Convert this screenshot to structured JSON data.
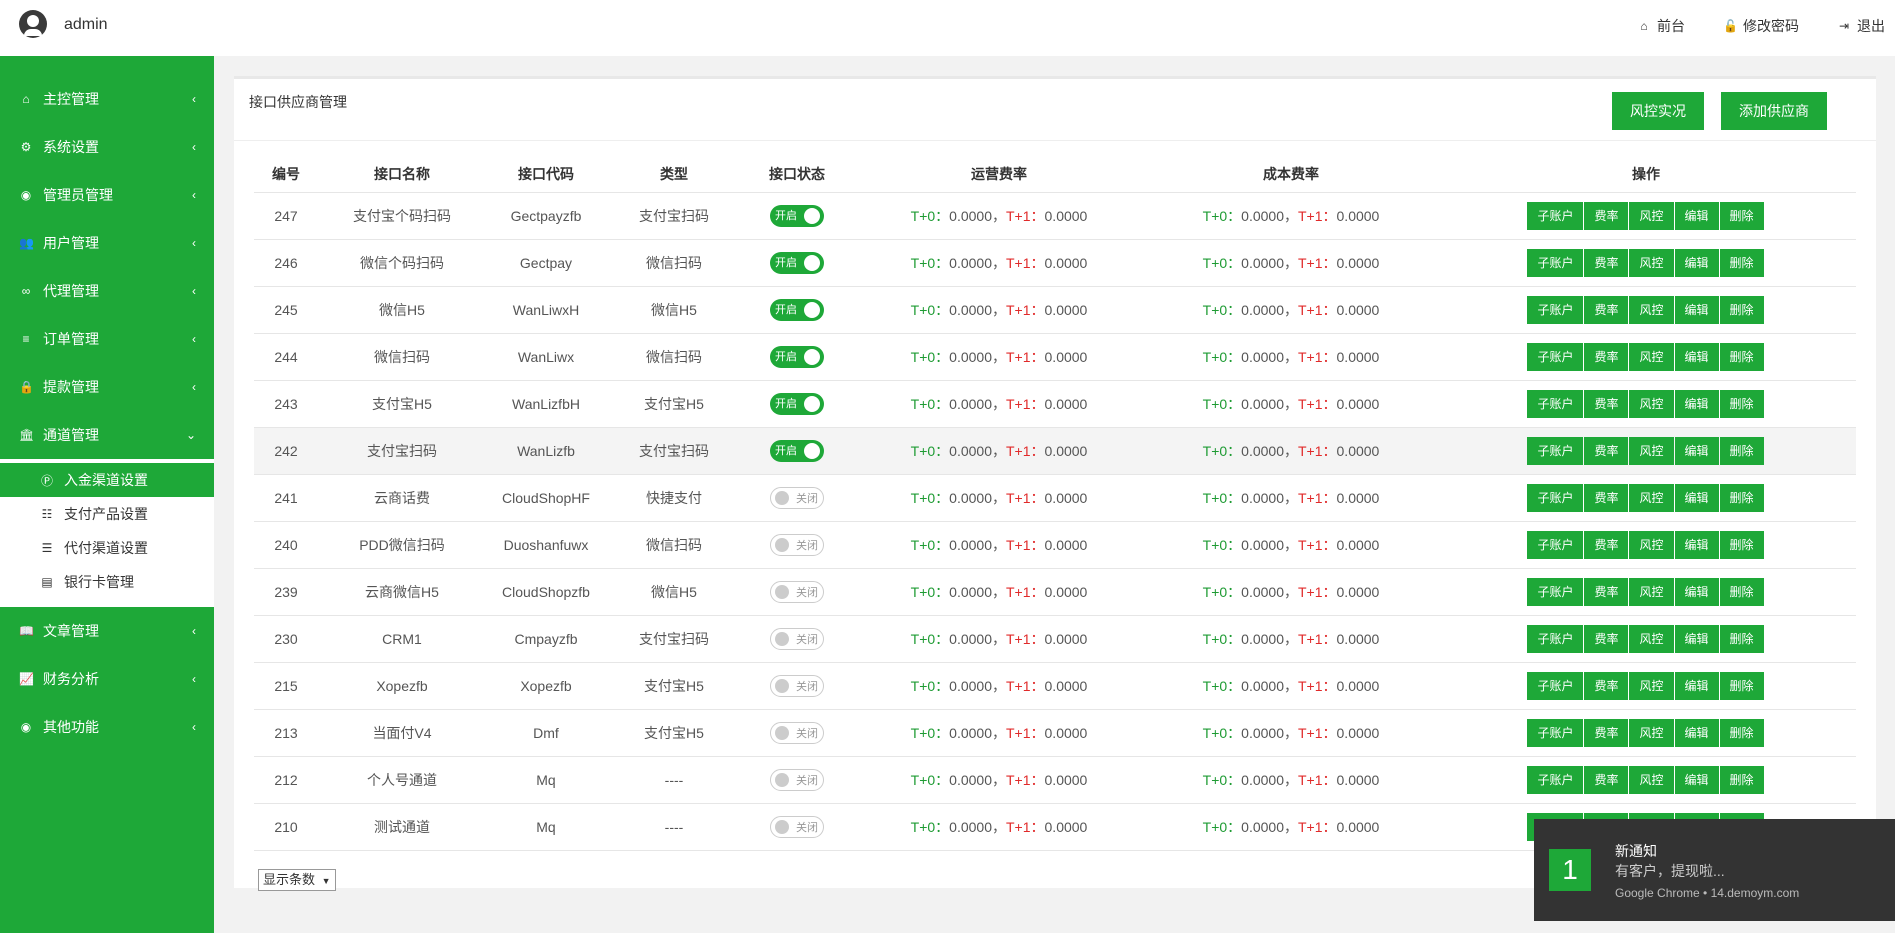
{
  "header": {
    "username": "admin",
    "links": [
      {
        "icon": "home-icon",
        "glyph": "⌂",
        "label": "前台"
      },
      {
        "icon": "unlock-icon",
        "glyph": "🔓",
        "label": "修改密码"
      },
      {
        "icon": "logout-icon",
        "glyph": "⇥",
        "label": "退出"
      }
    ]
  },
  "sidebar": {
    "items": [
      {
        "icon": "home-icon",
        "glyph": "⌂",
        "label": "主控管理"
      },
      {
        "icon": "gears-icon",
        "glyph": "⚙",
        "label": "系统设置"
      },
      {
        "icon": "user-circle-icon",
        "glyph": "◉",
        "label": "管理员管理"
      },
      {
        "icon": "users-icon",
        "glyph": "👥",
        "label": "用户管理"
      },
      {
        "icon": "handshake-icon",
        "glyph": "∞",
        "label": "代理管理"
      },
      {
        "icon": "list-icon",
        "glyph": "≡",
        "label": "订单管理"
      },
      {
        "icon": "lock-icon",
        "glyph": "🔒",
        "label": "提款管理"
      },
      {
        "icon": "bank-icon",
        "glyph": "🏛",
        "label": "通道管理"
      }
    ],
    "subitems": [
      {
        "icon": "product-hunt-icon",
        "glyph": "Ⓟ",
        "label": "入金渠道设置"
      },
      {
        "icon": "sitemap-icon",
        "glyph": "☷",
        "label": "支付产品设置"
      },
      {
        "icon": "sliders-icon",
        "glyph": "☰",
        "label": "代付渠道设置"
      },
      {
        "icon": "credit-card-icon",
        "glyph": "▤",
        "label": "银行卡管理"
      }
    ],
    "items_after": [
      {
        "icon": "book-icon",
        "glyph": "📖",
        "label": "文章管理"
      },
      {
        "icon": "line-chart-icon",
        "glyph": "📈",
        "label": "财务分析"
      },
      {
        "icon": "user-circle-icon",
        "glyph": "◉",
        "label": "其他功能"
      }
    ]
  },
  "panel": {
    "title": "接口供应商管理",
    "btn_risk": "风控实况",
    "btn_add": "添加供应商",
    "page_size": "显示条数"
  },
  "table": {
    "headers": [
      "编号",
      "接口名称",
      "接口代码",
      "类型",
      "接口状态",
      "运营费率",
      "成本费率",
      "操作"
    ],
    "on_label": "开启",
    "off_label": "关闭",
    "t0_label": "T+0：",
    "t1_label": "T+1：",
    "rate_sep": "，",
    "ops": [
      "子账户",
      "费率",
      "风控",
      "编辑",
      "删除"
    ],
    "rows": [
      {
        "id": "247",
        "name": "支付宝个码扫码",
        "code": "Gectpayzfb",
        "type": "支付宝扫码",
        "on": true,
        "op_t0": "0.0000",
        "op_t1": "0.0000",
        "cost_t0": "0.0000",
        "cost_t1": "0.0000"
      },
      {
        "id": "246",
        "name": "微信个码扫码",
        "code": "Gectpay",
        "type": "微信扫码",
        "on": true,
        "op_t0": "0.0000",
        "op_t1": "0.0000",
        "cost_t0": "0.0000",
        "cost_t1": "0.0000"
      },
      {
        "id": "245",
        "name": "微信H5",
        "code": "WanLiwxH",
        "type": "微信H5",
        "on": true,
        "op_t0": "0.0000",
        "op_t1": "0.0000",
        "cost_t0": "0.0000",
        "cost_t1": "0.0000"
      },
      {
        "id": "244",
        "name": "微信扫码",
        "code": "WanLiwx",
        "type": "微信扫码",
        "on": true,
        "op_t0": "0.0000",
        "op_t1": "0.0000",
        "cost_t0": "0.0000",
        "cost_t1": "0.0000"
      },
      {
        "id": "243",
        "name": "支付宝H5",
        "code": "WanLizfbH",
        "type": "支付宝H5",
        "on": true,
        "op_t0": "0.0000",
        "op_t1": "0.0000",
        "cost_t0": "0.0000",
        "cost_t1": "0.0000"
      },
      {
        "id": "242",
        "name": "支付宝扫码",
        "code": "WanLizfb",
        "type": "支付宝扫码",
        "on": true,
        "op_t0": "0.0000",
        "op_t1": "0.0000",
        "cost_t0": "0.0000",
        "cost_t1": "0.0000",
        "highlight": true
      },
      {
        "id": "241",
        "name": "云商话费",
        "code": "CloudShopHF",
        "type": "快捷支付",
        "on": false,
        "op_t0": "0.0000",
        "op_t1": "0.0000",
        "cost_t0": "0.0000",
        "cost_t1": "0.0000"
      },
      {
        "id": "240",
        "name": "PDD微信扫码",
        "code": "Duoshanfuwx",
        "type": "微信扫码",
        "on": false,
        "op_t0": "0.0000",
        "op_t1": "0.0000",
        "cost_t0": "0.0000",
        "cost_t1": "0.0000"
      },
      {
        "id": "239",
        "name": "云商微信H5",
        "code": "CloudShopzfb",
        "type": "微信H5",
        "on": false,
        "op_t0": "0.0000",
        "op_t1": "0.0000",
        "cost_t0": "0.0000",
        "cost_t1": "0.0000"
      },
      {
        "id": "230",
        "name": "CRM1",
        "code": "Cmpayzfb",
        "type": "支付宝扫码",
        "on": false,
        "op_t0": "0.0000",
        "op_t1": "0.0000",
        "cost_t0": "0.0000",
        "cost_t1": "0.0000"
      },
      {
        "id": "215",
        "name": "Xopezfb",
        "code": "Xopezfb",
        "type": "支付宝H5",
        "on": false,
        "op_t0": "0.0000",
        "op_t1": "0.0000",
        "cost_t0": "0.0000",
        "cost_t1": "0.0000"
      },
      {
        "id": "213",
        "name": "当面付V4",
        "code": "Dmf",
        "type": "支付宝H5",
        "on": false,
        "op_t0": "0.0000",
        "op_t1": "0.0000",
        "cost_t0": "0.0000",
        "cost_t1": "0.0000"
      },
      {
        "id": "212",
        "name": "个人号通道",
        "code": "Mq",
        "type": "----",
        "on": false,
        "op_t0": "0.0000",
        "op_t1": "0.0000",
        "cost_t0": "0.0000",
        "cost_t1": "0.0000"
      },
      {
        "id": "210",
        "name": "测试通道",
        "code": "Mq",
        "type": "----",
        "on": false,
        "op_t0": "0.0000",
        "op_t1": "0.0000",
        "cost_t0": "0.0000",
        "cost_t1": "0.0000"
      }
    ]
  },
  "toast": {
    "badge": "1",
    "title": "新通知",
    "message": "有客户，提现啦...",
    "source": "Google Chrome • 14.demoym.com"
  },
  "colors": {
    "brand": "#1ea838",
    "t0": "#1e9b33",
    "t1": "#e02a2a"
  }
}
